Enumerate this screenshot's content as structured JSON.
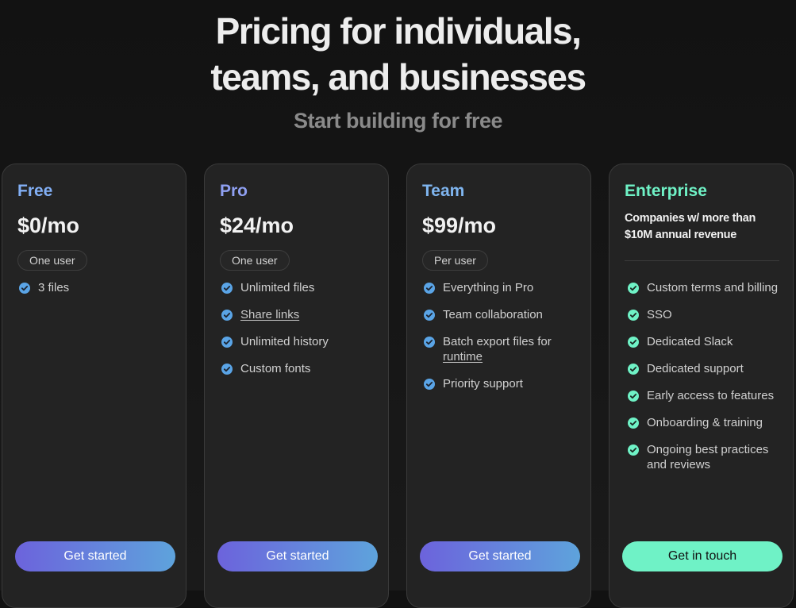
{
  "hero": {
    "title_line1": "Pricing for individuals,",
    "title_line2": "teams, and businesses",
    "subtitle": "Start building for free"
  },
  "colors": {
    "free": "#82aff5",
    "pro": "#8fa0f2",
    "team": "#7fb5ef",
    "enterprise": "#6ff2c6",
    "check_blue": "#5aa4e6",
    "check_green": "#6ff2c6"
  },
  "plans": [
    {
      "name": "Free",
      "price": "$0/mo",
      "badge": "One user",
      "features": [
        "3 files"
      ],
      "cta": "Get started"
    },
    {
      "name": "Pro",
      "price": "$24/mo",
      "badge": "One user",
      "features": [
        "Unlimited files",
        "Share links",
        "Unlimited history",
        "Custom fonts"
      ],
      "cta": "Get started"
    },
    {
      "name": "Team",
      "price": "$99/mo",
      "badge": "Per user",
      "features": [
        "Everything in Pro",
        "Team collaboration",
        "Batch export files for",
        "runtime",
        "Priority support"
      ],
      "cta": "Get started"
    },
    {
      "name": "Enterprise",
      "description": "Companies w/ more than $10M annual revenue",
      "features": [
        "Custom terms and billing",
        "SSO",
        "Dedicated Slack",
        "Dedicated support",
        "Early access to features",
        "Onboarding & training",
        "Ongoing best practices and reviews"
      ],
      "cta": "Get in touch"
    }
  ]
}
